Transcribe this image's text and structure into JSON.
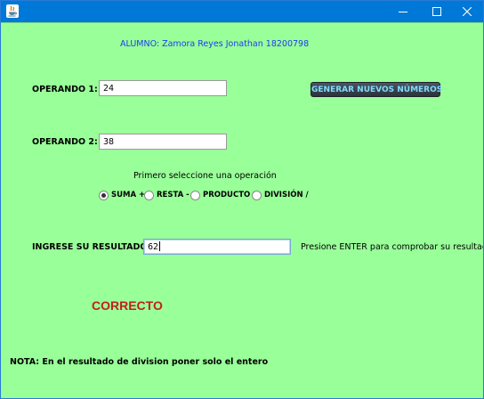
{
  "window": {
    "title": "",
    "controls": {
      "minimize": "minimize-icon",
      "maximize": "maximize-icon",
      "close": "close-icon"
    }
  },
  "header": {
    "student": "ALUMNO: Zamora Reyes Jonathan  18200798"
  },
  "operand1": {
    "label": "OPERANDO 1:",
    "value": "24"
  },
  "operand2": {
    "label": "OPERANDO 2:",
    "value": "38"
  },
  "generate_button": {
    "label": "GENERAR NUEVOS NÚMEROS"
  },
  "operation": {
    "prompt": "Primero seleccione una operación",
    "options": [
      {
        "label": "SUMA +",
        "checked": true
      },
      {
        "label": "RESTA -",
        "checked": false
      },
      {
        "label": "PRODUCTO *",
        "checked": false
      },
      {
        "label": "DIVISIÓN /",
        "checked": false
      }
    ]
  },
  "result": {
    "label": "INGRESE SU RESULTADO:",
    "value": "62",
    "hint": "Presione ENTER para comprobar su resultado"
  },
  "feedback": {
    "text": "CORRECTO"
  },
  "note": {
    "text": "NOTA: En el resultado de division poner solo el entero"
  },
  "colors": {
    "background": "#99ff99",
    "titlebar": "#0078d7",
    "student_text": "#1c3cf0",
    "correct_text": "#c0201a",
    "button_text": "#7fdcff"
  }
}
